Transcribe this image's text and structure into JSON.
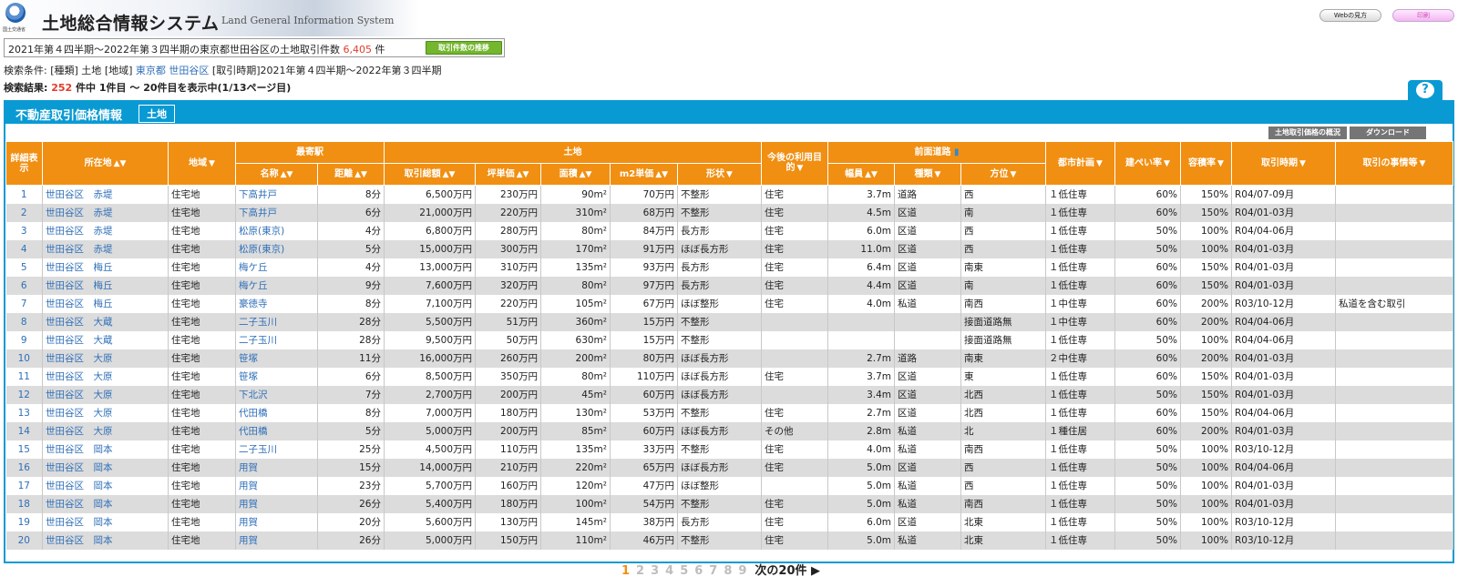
{
  "header": {
    "logo_sub": "国土交通省",
    "title": "土地総合情報システム",
    "title_en": "Land General Information System",
    "web_button": "Webの見方",
    "print_button": "印刷"
  },
  "count_bar": {
    "prefix": "2021年第４四半期～2022年第３四半期の東京都世田谷区の土地取引件数",
    "count": "6,405",
    "suffix": "件",
    "trend_button": "取引件数の推移"
  },
  "conditions": {
    "label": "検索条件:",
    "type": "[種類] 土地",
    "region_label": "[地域]",
    "prefecture": "東京都",
    "ward": "世田谷区",
    "period": "[取引時期]2021年第４四半期～2022年第３四半期"
  },
  "result": {
    "label": "検索結果:",
    "count": "252",
    "text": "件中 1件目 ～ 20件目を表示中(1/13ページ目)"
  },
  "panel": {
    "title": "不動産取引価格情報",
    "tag": "土地",
    "overview_button": "土地取引価格の概況",
    "download_button": "ダウンロード"
  },
  "columns": {
    "detail": "詳細表示",
    "location": "所在地",
    "area_type": "地域",
    "station_group": "最寄駅",
    "station_name": "名称",
    "distance": "距離",
    "land_group": "土地",
    "total": "取引総額",
    "tsubo": "坪単価",
    "area": "面積",
    "m2_price": "m2単価",
    "shape": "形状",
    "purpose": "今後の利用目的",
    "road_group": "前面道路",
    "width": "幅員",
    "road_type": "種類",
    "direction": "方位",
    "city_plan": "都市計画",
    "coverage": "建ぺい率",
    "far": "容積率",
    "period": "取引時期",
    "notes": "取引の事情等"
  },
  "rows": [
    {
      "no": "1",
      "loc": "世田谷区　赤堤",
      "type": "住宅地",
      "station": "下高井戸",
      "dist": "8分",
      "total": "6,500万円",
      "tsubo": "230万円",
      "area": "90m²",
      "unit": "70万円",
      "shape": "不整形",
      "purpose": "住宅",
      "width": "3.7m",
      "road": "道路",
      "dir": "西",
      "plan": "１低住専",
      "cov": "60%",
      "far": "150%",
      "period": "R04/07-09月",
      "notes": ""
    },
    {
      "no": "2",
      "loc": "世田谷区　赤堤",
      "type": "住宅地",
      "station": "下高井戸",
      "dist": "6分",
      "total": "21,000万円",
      "tsubo": "220万円",
      "area": "310m²",
      "unit": "68万円",
      "shape": "不整形",
      "purpose": "住宅",
      "width": "4.5m",
      "road": "区道",
      "dir": "南",
      "plan": "１低住専",
      "cov": "60%",
      "far": "150%",
      "period": "R04/01-03月",
      "notes": ""
    },
    {
      "no": "3",
      "loc": "世田谷区　赤堤",
      "type": "住宅地",
      "station": "松原(東京)",
      "dist": "4分",
      "total": "6,800万円",
      "tsubo": "280万円",
      "area": "80m²",
      "unit": "84万円",
      "shape": "長方形",
      "purpose": "住宅",
      "width": "6.0m",
      "road": "区道",
      "dir": "西",
      "plan": "１低住専",
      "cov": "50%",
      "far": "100%",
      "period": "R04/04-06月",
      "notes": ""
    },
    {
      "no": "4",
      "loc": "世田谷区　赤堤",
      "type": "住宅地",
      "station": "松原(東京)",
      "dist": "5分",
      "total": "15,000万円",
      "tsubo": "300万円",
      "area": "170m²",
      "unit": "91万円",
      "shape": "ほぼ長方形",
      "purpose": "住宅",
      "width": "11.0m",
      "road": "区道",
      "dir": "西",
      "plan": "１低住専",
      "cov": "50%",
      "far": "100%",
      "period": "R04/01-03月",
      "notes": ""
    },
    {
      "no": "5",
      "loc": "世田谷区　梅丘",
      "type": "住宅地",
      "station": "梅ケ丘",
      "dist": "4分",
      "total": "13,000万円",
      "tsubo": "310万円",
      "area": "135m²",
      "unit": "93万円",
      "shape": "長方形",
      "purpose": "住宅",
      "width": "6.4m",
      "road": "区道",
      "dir": "南東",
      "plan": "１低住専",
      "cov": "60%",
      "far": "150%",
      "period": "R04/01-03月",
      "notes": ""
    },
    {
      "no": "6",
      "loc": "世田谷区　梅丘",
      "type": "住宅地",
      "station": "梅ケ丘",
      "dist": "9分",
      "total": "7,600万円",
      "tsubo": "320万円",
      "area": "80m²",
      "unit": "97万円",
      "shape": "長方形",
      "purpose": "住宅",
      "width": "4.4m",
      "road": "区道",
      "dir": "南",
      "plan": "１低住専",
      "cov": "60%",
      "far": "150%",
      "period": "R04/01-03月",
      "notes": ""
    },
    {
      "no": "7",
      "loc": "世田谷区　梅丘",
      "type": "住宅地",
      "station": "豪徳寺",
      "dist": "8分",
      "total": "7,100万円",
      "tsubo": "220万円",
      "area": "105m²",
      "unit": "67万円",
      "shape": "ほぼ整形",
      "purpose": "住宅",
      "width": "4.0m",
      "road": "私道",
      "dir": "南西",
      "plan": "１中住専",
      "cov": "60%",
      "far": "200%",
      "period": "R03/10-12月",
      "notes": "私道を含む取引"
    },
    {
      "no": "8",
      "loc": "世田谷区　大蔵",
      "type": "住宅地",
      "station": "二子玉川",
      "dist": "28分",
      "total": "5,500万円",
      "tsubo": "51万円",
      "area": "360m²",
      "unit": "15万円",
      "shape": "不整形",
      "purpose": "",
      "width": "",
      "road": "",
      "dir": "接面道路無",
      "plan": "１中住専",
      "cov": "60%",
      "far": "200%",
      "period": "R04/04-06月",
      "notes": ""
    },
    {
      "no": "9",
      "loc": "世田谷区　大蔵",
      "type": "住宅地",
      "station": "二子玉川",
      "dist": "28分",
      "total": "9,500万円",
      "tsubo": "50万円",
      "area": "630m²",
      "unit": "15万円",
      "shape": "不整形",
      "purpose": "",
      "width": "",
      "road": "",
      "dir": "接面道路無",
      "plan": "１低住専",
      "cov": "50%",
      "far": "100%",
      "period": "R04/04-06月",
      "notes": ""
    },
    {
      "no": "10",
      "loc": "世田谷区　大原",
      "type": "住宅地",
      "station": "笹塚",
      "dist": "11分",
      "total": "16,000万円",
      "tsubo": "260万円",
      "area": "200m²",
      "unit": "80万円",
      "shape": "ほぼ長方形",
      "purpose": "",
      "width": "2.7m",
      "road": "道路",
      "dir": "南東",
      "plan": "２中住専",
      "cov": "60%",
      "far": "200%",
      "period": "R04/01-03月",
      "notes": ""
    },
    {
      "no": "11",
      "loc": "世田谷区　大原",
      "type": "住宅地",
      "station": "笹塚",
      "dist": "6分",
      "total": "8,500万円",
      "tsubo": "350万円",
      "area": "80m²",
      "unit": "110万円",
      "shape": "ほぼ長方形",
      "purpose": "住宅",
      "width": "3.7m",
      "road": "区道",
      "dir": "東",
      "plan": "１低住専",
      "cov": "60%",
      "far": "150%",
      "period": "R04/01-03月",
      "notes": ""
    },
    {
      "no": "12",
      "loc": "世田谷区　大原",
      "type": "住宅地",
      "station": "下北沢",
      "dist": "7分",
      "total": "2,700万円",
      "tsubo": "200万円",
      "area": "45m²",
      "unit": "60万円",
      "shape": "ほぼ長方形",
      "purpose": "",
      "width": "3.4m",
      "road": "区道",
      "dir": "北西",
      "plan": "１低住専",
      "cov": "50%",
      "far": "150%",
      "period": "R04/01-03月",
      "notes": ""
    },
    {
      "no": "13",
      "loc": "世田谷区　大原",
      "type": "住宅地",
      "station": "代田橋",
      "dist": "8分",
      "total": "7,000万円",
      "tsubo": "180万円",
      "area": "130m²",
      "unit": "53万円",
      "shape": "不整形",
      "purpose": "住宅",
      "width": "2.7m",
      "road": "区道",
      "dir": "北西",
      "plan": "１低住専",
      "cov": "60%",
      "far": "150%",
      "period": "R04/04-06月",
      "notes": ""
    },
    {
      "no": "14",
      "loc": "世田谷区　大原",
      "type": "住宅地",
      "station": "代田橋",
      "dist": "5分",
      "total": "5,000万円",
      "tsubo": "200万円",
      "area": "85m²",
      "unit": "60万円",
      "shape": "ほぼ長方形",
      "purpose": "その他",
      "width": "2.8m",
      "road": "私道",
      "dir": "北",
      "plan": "１種住居",
      "cov": "60%",
      "far": "200%",
      "period": "R04/01-03月",
      "notes": ""
    },
    {
      "no": "15",
      "loc": "世田谷区　岡本",
      "type": "住宅地",
      "station": "二子玉川",
      "dist": "25分",
      "total": "4,500万円",
      "tsubo": "110万円",
      "area": "135m²",
      "unit": "33万円",
      "shape": "不整形",
      "purpose": "住宅",
      "width": "4.0m",
      "road": "私道",
      "dir": "南西",
      "plan": "１低住専",
      "cov": "50%",
      "far": "100%",
      "period": "R03/10-12月",
      "notes": ""
    },
    {
      "no": "16",
      "loc": "世田谷区　岡本",
      "type": "住宅地",
      "station": "用賀",
      "dist": "15分",
      "total": "14,000万円",
      "tsubo": "210万円",
      "area": "220m²",
      "unit": "65万円",
      "shape": "ほぼ長方形",
      "purpose": "住宅",
      "width": "5.0m",
      "road": "区道",
      "dir": "西",
      "plan": "１低住専",
      "cov": "50%",
      "far": "100%",
      "period": "R04/04-06月",
      "notes": ""
    },
    {
      "no": "17",
      "loc": "世田谷区　岡本",
      "type": "住宅地",
      "station": "用賀",
      "dist": "23分",
      "total": "5,700万円",
      "tsubo": "160万円",
      "area": "120m²",
      "unit": "47万円",
      "shape": "ほぼ整形",
      "purpose": "",
      "width": "5.0m",
      "road": "私道",
      "dir": "西",
      "plan": "１低住専",
      "cov": "50%",
      "far": "100%",
      "period": "R04/01-03月",
      "notes": ""
    },
    {
      "no": "18",
      "loc": "世田谷区　岡本",
      "type": "住宅地",
      "station": "用賀",
      "dist": "26分",
      "total": "5,400万円",
      "tsubo": "180万円",
      "area": "100m²",
      "unit": "54万円",
      "shape": "不整形",
      "purpose": "住宅",
      "width": "5.0m",
      "road": "私道",
      "dir": "南西",
      "plan": "１低住専",
      "cov": "50%",
      "far": "100%",
      "period": "R04/01-03月",
      "notes": ""
    },
    {
      "no": "19",
      "loc": "世田谷区　岡本",
      "type": "住宅地",
      "station": "用賀",
      "dist": "20分",
      "total": "5,600万円",
      "tsubo": "130万円",
      "area": "145m²",
      "unit": "38万円",
      "shape": "長方形",
      "purpose": "住宅",
      "width": "6.0m",
      "road": "区道",
      "dir": "北東",
      "plan": "１低住専",
      "cov": "50%",
      "far": "100%",
      "period": "R03/10-12月",
      "notes": ""
    },
    {
      "no": "20",
      "loc": "世田谷区　岡本",
      "type": "住宅地",
      "station": "用賀",
      "dist": "26分",
      "total": "5,000万円",
      "tsubo": "150万円",
      "area": "110m²",
      "unit": "46万円",
      "shape": "不整形",
      "purpose": "住宅",
      "width": "5.0m",
      "road": "私道",
      "dir": "北東",
      "plan": "１低住専",
      "cov": "50%",
      "far": "100%",
      "period": "R03/10-12月",
      "notes": ""
    }
  ],
  "pagination": {
    "pages": [
      "1",
      "2",
      "3",
      "4",
      "5",
      "6",
      "7",
      "8",
      "9"
    ],
    "current": "1",
    "next": "次の20件 ▶"
  }
}
